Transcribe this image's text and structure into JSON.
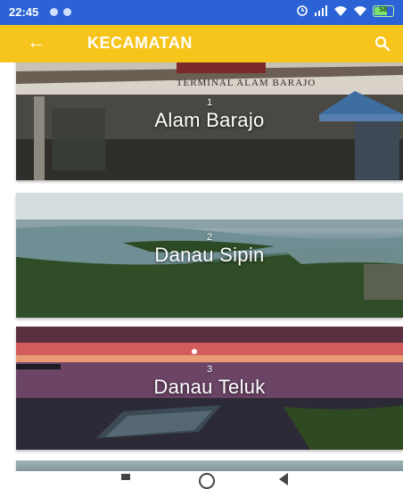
{
  "status_bar": {
    "time": "22:45",
    "battery": "58"
  },
  "app_bar": {
    "title": "KECAMATAN"
  },
  "cards": [
    {
      "number": "1",
      "name": "Alam Barajo",
      "sign_text": "TERMINAL ALAM BARAJO"
    },
    {
      "number": "2",
      "name": "Danau Sipin"
    },
    {
      "number": "3",
      "name": "Danau Teluk"
    }
  ],
  "colors": {
    "status_bar": "#2b63d6",
    "app_bar": "#f6c41b",
    "text_on_bar": "#ffffff"
  }
}
